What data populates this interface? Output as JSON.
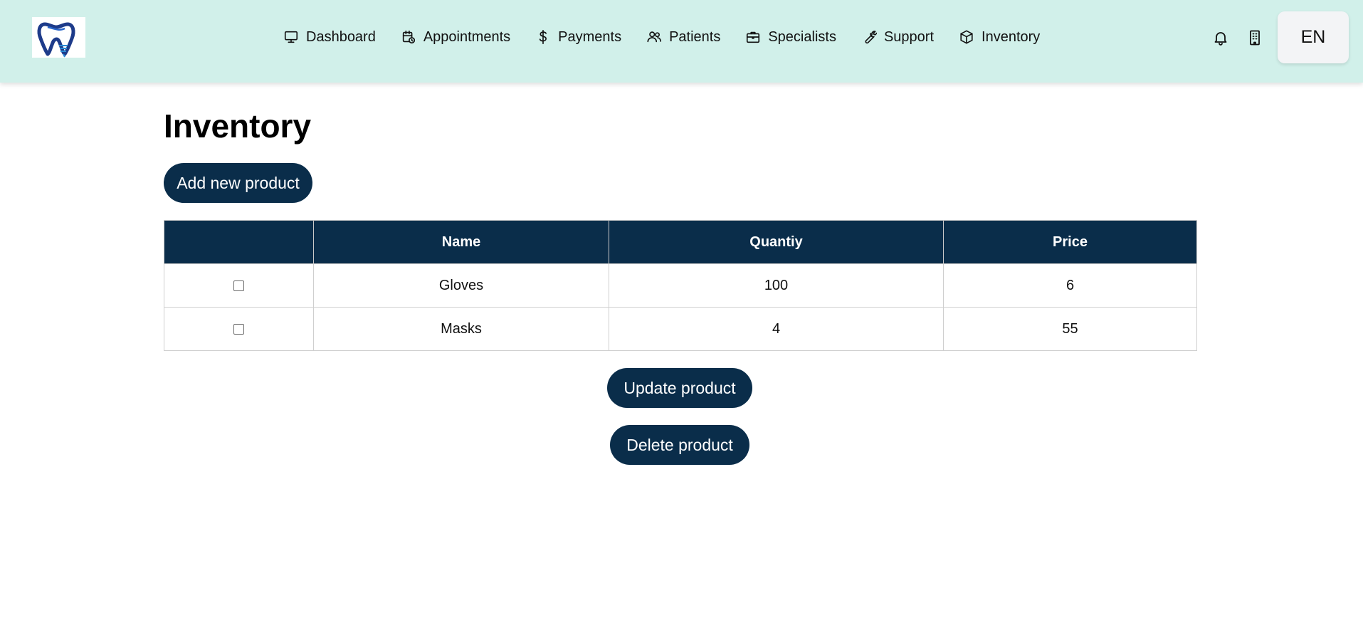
{
  "header": {
    "logo_icon": "tooth-logo-icon",
    "nav": [
      {
        "label": "Dashboard",
        "icon": "monitor-icon"
      },
      {
        "label": "Appointments",
        "icon": "calendar-clock-icon"
      },
      {
        "label": "Payments",
        "icon": "dollar-icon"
      },
      {
        "label": "Patients",
        "icon": "users-icon"
      },
      {
        "label": "Specialists",
        "icon": "briefcase-icon"
      },
      {
        "label": "Support",
        "icon": "wrench-icon"
      },
      {
        "label": "Inventory",
        "icon": "box-icon"
      }
    ],
    "notification_icon": "bell-icon",
    "building_icon": "building-icon",
    "language": "EN"
  },
  "page": {
    "title": "Inventory",
    "add_button": "Add new product",
    "update_button": "Update product",
    "delete_button": "Delete product"
  },
  "table": {
    "columns": [
      "",
      "Name",
      "Quantiy",
      "Price"
    ],
    "rows": [
      {
        "checked": false,
        "name": "Gloves",
        "quantity": "100",
        "price": "6"
      },
      {
        "checked": false,
        "name": "Masks",
        "quantity": "4",
        "price": "55"
      }
    ]
  },
  "colors": {
    "header_bg": "#d1f0ea",
    "primary": "#0a2d4a",
    "lang_button_bg": "#f3f4f6"
  }
}
